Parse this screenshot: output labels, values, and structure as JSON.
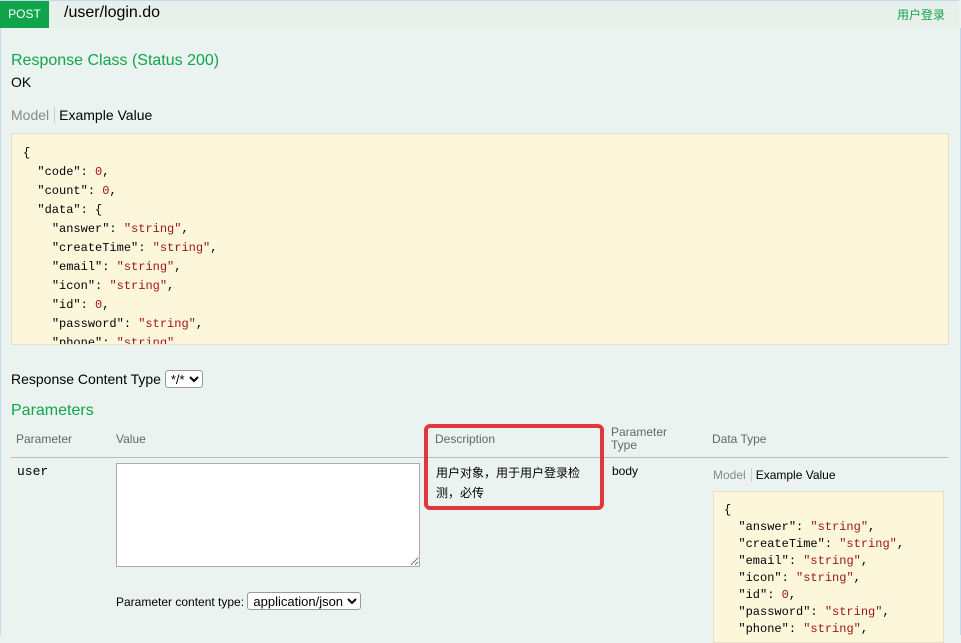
{
  "endpoint": {
    "method": "POST",
    "path": "/user/login.do",
    "summary": "用户登录"
  },
  "response": {
    "title": "Response Class (Status 200)",
    "status_text": "OK",
    "tabs": {
      "model": "Model",
      "example": "Example Value"
    },
    "example_lines": [
      "{",
      "  \"code\": 0,",
      "  \"count\": 0,",
      "  \"data\": {",
      "    \"answer\": \"string\",",
      "    \"createTime\": \"string\",",
      "    \"email\": \"string\",",
      "    \"icon\": \"string\",",
      "    \"id\": 0,",
      "    \"password\": \"string\",",
      "    \"phone\": \"string\","
    ],
    "content_type_label": "Response Content Type",
    "content_type_value": "*/*"
  },
  "parameters": {
    "title": "Parameters",
    "headers": {
      "parameter": "Parameter",
      "value": "Value",
      "description": "Description",
      "parameter_type": "Parameter Type",
      "data_type": "Data Type"
    },
    "rows": [
      {
        "name": "user",
        "value": "",
        "description": "用户对象，用于用户登录检测，必传",
        "parameter_type": "body",
        "content_type_label": "Parameter content type:",
        "content_type_value": "application/json",
        "model_tabs": {
          "model": "Model",
          "example": "Example Value"
        },
        "example_lines": [
          "{",
          "  \"answer\": \"string\",",
          "  \"createTime\": \"string\",",
          "  \"email\": \"string\",",
          "  \"icon\": \"string\",",
          "  \"id\": 0,",
          "  \"password\": \"string\",",
          "  \"phone\": \"string\","
        ]
      }
    ]
  },
  "colors": {
    "method_bg": "#10a54a",
    "accent_green": "#10a54a",
    "highlight_red": "#e0373a",
    "code_bg": "#fcf6db",
    "page_bg": "#ebf3f0"
  }
}
